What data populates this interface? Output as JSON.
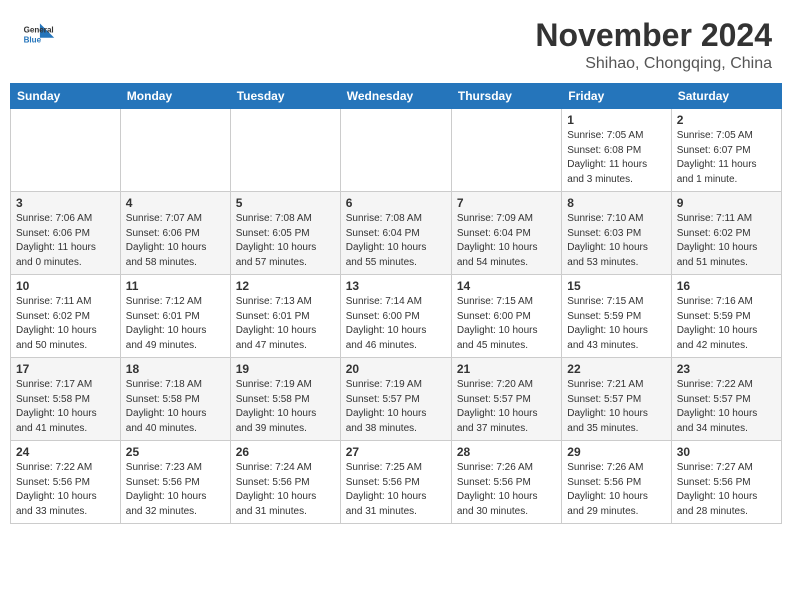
{
  "header": {
    "logo_line1": "General",
    "logo_line2": "Blue",
    "month_title": "November 2024",
    "location": "Shihao, Chongqing, China"
  },
  "weekdays": [
    "Sunday",
    "Monday",
    "Tuesday",
    "Wednesday",
    "Thursday",
    "Friday",
    "Saturday"
  ],
  "weeks": [
    [
      {
        "day": "",
        "info": ""
      },
      {
        "day": "",
        "info": ""
      },
      {
        "day": "",
        "info": ""
      },
      {
        "day": "",
        "info": ""
      },
      {
        "day": "",
        "info": ""
      },
      {
        "day": "1",
        "info": "Sunrise: 7:05 AM\nSunset: 6:08 PM\nDaylight: 11 hours\nand 3 minutes."
      },
      {
        "day": "2",
        "info": "Sunrise: 7:05 AM\nSunset: 6:07 PM\nDaylight: 11 hours\nand 1 minute."
      }
    ],
    [
      {
        "day": "3",
        "info": "Sunrise: 7:06 AM\nSunset: 6:06 PM\nDaylight: 11 hours\nand 0 minutes."
      },
      {
        "day": "4",
        "info": "Sunrise: 7:07 AM\nSunset: 6:06 PM\nDaylight: 10 hours\nand 58 minutes."
      },
      {
        "day": "5",
        "info": "Sunrise: 7:08 AM\nSunset: 6:05 PM\nDaylight: 10 hours\nand 57 minutes."
      },
      {
        "day": "6",
        "info": "Sunrise: 7:08 AM\nSunset: 6:04 PM\nDaylight: 10 hours\nand 55 minutes."
      },
      {
        "day": "7",
        "info": "Sunrise: 7:09 AM\nSunset: 6:04 PM\nDaylight: 10 hours\nand 54 minutes."
      },
      {
        "day": "8",
        "info": "Sunrise: 7:10 AM\nSunset: 6:03 PM\nDaylight: 10 hours\nand 53 minutes."
      },
      {
        "day": "9",
        "info": "Sunrise: 7:11 AM\nSunset: 6:02 PM\nDaylight: 10 hours\nand 51 minutes."
      }
    ],
    [
      {
        "day": "10",
        "info": "Sunrise: 7:11 AM\nSunset: 6:02 PM\nDaylight: 10 hours\nand 50 minutes."
      },
      {
        "day": "11",
        "info": "Sunrise: 7:12 AM\nSunset: 6:01 PM\nDaylight: 10 hours\nand 49 minutes."
      },
      {
        "day": "12",
        "info": "Sunrise: 7:13 AM\nSunset: 6:01 PM\nDaylight: 10 hours\nand 47 minutes."
      },
      {
        "day": "13",
        "info": "Sunrise: 7:14 AM\nSunset: 6:00 PM\nDaylight: 10 hours\nand 46 minutes."
      },
      {
        "day": "14",
        "info": "Sunrise: 7:15 AM\nSunset: 6:00 PM\nDaylight: 10 hours\nand 45 minutes."
      },
      {
        "day": "15",
        "info": "Sunrise: 7:15 AM\nSunset: 5:59 PM\nDaylight: 10 hours\nand 43 minutes."
      },
      {
        "day": "16",
        "info": "Sunrise: 7:16 AM\nSunset: 5:59 PM\nDaylight: 10 hours\nand 42 minutes."
      }
    ],
    [
      {
        "day": "17",
        "info": "Sunrise: 7:17 AM\nSunset: 5:58 PM\nDaylight: 10 hours\nand 41 minutes."
      },
      {
        "day": "18",
        "info": "Sunrise: 7:18 AM\nSunset: 5:58 PM\nDaylight: 10 hours\nand 40 minutes."
      },
      {
        "day": "19",
        "info": "Sunrise: 7:19 AM\nSunset: 5:58 PM\nDaylight: 10 hours\nand 39 minutes."
      },
      {
        "day": "20",
        "info": "Sunrise: 7:19 AM\nSunset: 5:57 PM\nDaylight: 10 hours\nand 38 minutes."
      },
      {
        "day": "21",
        "info": "Sunrise: 7:20 AM\nSunset: 5:57 PM\nDaylight: 10 hours\nand 37 minutes."
      },
      {
        "day": "22",
        "info": "Sunrise: 7:21 AM\nSunset: 5:57 PM\nDaylight: 10 hours\nand 35 minutes."
      },
      {
        "day": "23",
        "info": "Sunrise: 7:22 AM\nSunset: 5:57 PM\nDaylight: 10 hours\nand 34 minutes."
      }
    ],
    [
      {
        "day": "24",
        "info": "Sunrise: 7:22 AM\nSunset: 5:56 PM\nDaylight: 10 hours\nand 33 minutes."
      },
      {
        "day": "25",
        "info": "Sunrise: 7:23 AM\nSunset: 5:56 PM\nDaylight: 10 hours\nand 32 minutes."
      },
      {
        "day": "26",
        "info": "Sunrise: 7:24 AM\nSunset: 5:56 PM\nDaylight: 10 hours\nand 31 minutes."
      },
      {
        "day": "27",
        "info": "Sunrise: 7:25 AM\nSunset: 5:56 PM\nDaylight: 10 hours\nand 31 minutes."
      },
      {
        "day": "28",
        "info": "Sunrise: 7:26 AM\nSunset: 5:56 PM\nDaylight: 10 hours\nand 30 minutes."
      },
      {
        "day": "29",
        "info": "Sunrise: 7:26 AM\nSunset: 5:56 PM\nDaylight: 10 hours\nand 29 minutes."
      },
      {
        "day": "30",
        "info": "Sunrise: 7:27 AM\nSunset: 5:56 PM\nDaylight: 10 hours\nand 28 minutes."
      }
    ]
  ]
}
